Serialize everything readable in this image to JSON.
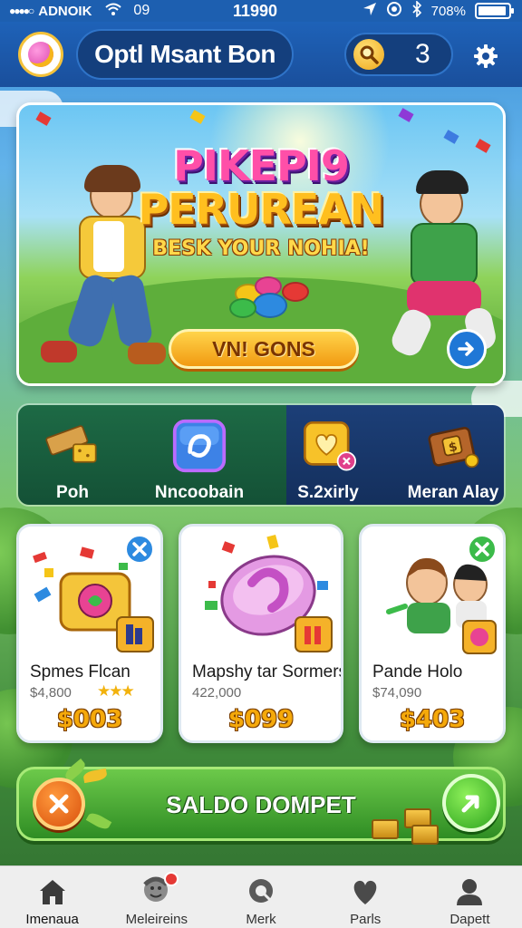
{
  "status_bar": {
    "signal": "●●●●○",
    "carrier": "ADNOIK",
    "network": "09",
    "time": "11990",
    "battery": "708%",
    "battery_level": 0.95
  },
  "header": {
    "title": "Optl Msant Bon",
    "search_count": "3"
  },
  "hero": {
    "title_line1": "PIKEPI9",
    "title_line2": "PERUREAN",
    "subtitle": "BESK YOUR NOHIA!",
    "cta_label": "VN! GONS"
  },
  "categories": [
    {
      "label": "Poh",
      "icon": "bricks-icon"
    },
    {
      "label": "Nncoobain",
      "icon": "blue-gem-icon"
    },
    {
      "label": "S.2xirly",
      "icon": "heart-box-icon"
    },
    {
      "label": "Meran Alay",
      "icon": "treasure-chest-icon"
    }
  ],
  "cards": [
    {
      "name": "Spmes Flcan",
      "sub": "$4,800",
      "stars": "★★★",
      "price": "$003",
      "badge": "close"
    },
    {
      "name": "Mapshy tar Sormers",
      "sub": "422,000",
      "stars": "",
      "price": "$099",
      "badge": "none"
    },
    {
      "name": "Pande Holo",
      "sub": "$74,090",
      "stars": "",
      "price": "$403",
      "badge": "check"
    }
  ],
  "action_bar": {
    "label": "SALDO DOMPET"
  },
  "bottom_nav": [
    {
      "label": "Imenaua",
      "icon": "home-icon"
    },
    {
      "label": "Meleireins",
      "icon": "friends-icon"
    },
    {
      "label": "Merk",
      "icon": "search-icon"
    },
    {
      "label": "Parls",
      "icon": "heart-icon"
    },
    {
      "label": "Dapett",
      "icon": "profile-icon"
    }
  ],
  "colors": {
    "header_bg": "#1e62b8",
    "accent_gold": "#f5a90a",
    "action_green": "#2f8d24",
    "nav_bg": "#eeeeee"
  }
}
